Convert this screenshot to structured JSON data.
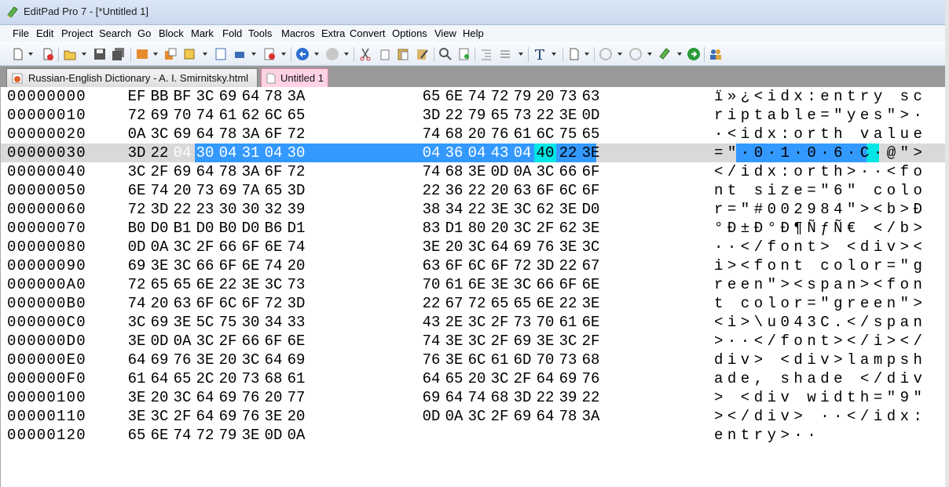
{
  "window": {
    "title": "EditPad Pro 7 - [*Untitled 1]"
  },
  "menu": [
    "File",
    "Edit",
    "Project",
    "Search",
    "Go",
    "Block",
    "Mark",
    "Fold",
    "Tools",
    "Macros",
    "Extra",
    "Convert",
    "Options",
    "View",
    "Help"
  ],
  "tabs": [
    {
      "label": "Russian-English Dictionary - A. I. Smirnitsky.html",
      "active": false
    },
    {
      "label": "Untitled 1",
      "active": true
    }
  ],
  "hex_rows": [
    {
      "addr": "00000000",
      "bytes": [
        "EF",
        "BB",
        "BF",
        "3C",
        "69",
        "64",
        "78",
        "3A",
        "65",
        "6E",
        "74",
        "72",
        "79",
        "20",
        "73",
        "63"
      ],
      "ascii": "ï»¿<idx:entry sc"
    },
    {
      "addr": "00000010",
      "bytes": [
        "72",
        "69",
        "70",
        "74",
        "61",
        "62",
        "6C",
        "65",
        "3D",
        "22",
        "79",
        "65",
        "73",
        "22",
        "3E",
        "0D"
      ],
      "ascii": "riptable=\"yes\">·"
    },
    {
      "addr": "00000020",
      "bytes": [
        "0A",
        "3C",
        "69",
        "64",
        "78",
        "3A",
        "6F",
        "72",
        "74",
        "68",
        "20",
        "76",
        "61",
        "6C",
        "75",
        "65"
      ],
      "ascii": "·<idx:orth value"
    },
    {
      "addr": "00000030",
      "bytes": [
        "3D",
        "22",
        "04",
        "30",
        "04",
        "31",
        "04",
        "30",
        "04",
        "36",
        "04",
        "43",
        "04",
        "40",
        "22",
        "3E"
      ],
      "ascii": "=\"·0·1·0·6·C·@\">"
    },
    {
      "addr": "00000040",
      "bytes": [
        "3C",
        "2F",
        "69",
        "64",
        "78",
        "3A",
        "6F",
        "72",
        "74",
        "68",
        "3E",
        "0D",
        "0A",
        "3C",
        "66",
        "6F"
      ],
      "ascii": "</idx:orth>··<fo"
    },
    {
      "addr": "00000050",
      "bytes": [
        "6E",
        "74",
        "20",
        "73",
        "69",
        "7A",
        "65",
        "3D",
        "22",
        "36",
        "22",
        "20",
        "63",
        "6F",
        "6C",
        "6F"
      ],
      "ascii": "nt size=\"6\" colo"
    },
    {
      "addr": "00000060",
      "bytes": [
        "72",
        "3D",
        "22",
        "23",
        "30",
        "30",
        "32",
        "39",
        "38",
        "34",
        "22",
        "3E",
        "3C",
        "62",
        "3E",
        "D0"
      ],
      "ascii": "r=\"#002984\"><b>Ð"
    },
    {
      "addr": "00000070",
      "bytes": [
        "B0",
        "D0",
        "B1",
        "D0",
        "B0",
        "D0",
        "B6",
        "D1",
        "83",
        "D1",
        "80",
        "20",
        "3C",
        "2F",
        "62",
        "3E"
      ],
      "ascii": "°Ð±Ð°Ð¶ÑƒÑ€ </b>"
    },
    {
      "addr": "00000080",
      "bytes": [
        "0D",
        "0A",
        "3C",
        "2F",
        "66",
        "6F",
        "6E",
        "74",
        "3E",
        "20",
        "3C",
        "64",
        "69",
        "76",
        "3E",
        "3C"
      ],
      "ascii": "··</font> <div><"
    },
    {
      "addr": "00000090",
      "bytes": [
        "69",
        "3E",
        "3C",
        "66",
        "6F",
        "6E",
        "74",
        "20",
        "63",
        "6F",
        "6C",
        "6F",
        "72",
        "3D",
        "22",
        "67"
      ],
      "ascii": "i><font color=\"g"
    },
    {
      "addr": "000000A0",
      "bytes": [
        "72",
        "65",
        "65",
        "6E",
        "22",
        "3E",
        "3C",
        "73",
        "70",
        "61",
        "6E",
        "3E",
        "3C",
        "66",
        "6F",
        "6E"
      ],
      "ascii": "reen\"><span><fon"
    },
    {
      "addr": "000000B0",
      "bytes": [
        "74",
        "20",
        "63",
        "6F",
        "6C",
        "6F",
        "72",
        "3D",
        "22",
        "67",
        "72",
        "65",
        "65",
        "6E",
        "22",
        "3E"
      ],
      "ascii": "t color=\"green\">"
    },
    {
      "addr": "000000C0",
      "bytes": [
        "3C",
        "69",
        "3E",
        "5C",
        "75",
        "30",
        "34",
        "33",
        "43",
        "2E",
        "3C",
        "2F",
        "73",
        "70",
        "61",
        "6E"
      ],
      "ascii": "<i>\\u043C.</span"
    },
    {
      "addr": "000000D0",
      "bytes": [
        "3E",
        "0D",
        "0A",
        "3C",
        "2F",
        "66",
        "6F",
        "6E",
        "74",
        "3E",
        "3C",
        "2F",
        "69",
        "3E",
        "3C",
        "2F"
      ],
      "ascii": ">··</font></i></"
    },
    {
      "addr": "000000E0",
      "bytes": [
        "64",
        "69",
        "76",
        "3E",
        "20",
        "3C",
        "64",
        "69",
        "76",
        "3E",
        "6C",
        "61",
        "6D",
        "70",
        "73",
        "68"
      ],
      "ascii": "div> <div>lampsh"
    },
    {
      "addr": "000000F0",
      "bytes": [
        "61",
        "64",
        "65",
        "2C",
        "20",
        "73",
        "68",
        "61",
        "64",
        "65",
        "20",
        "3C",
        "2F",
        "64",
        "69",
        "76"
      ],
      "ascii": "ade, shade </div"
    },
    {
      "addr": "00000100",
      "bytes": [
        "3E",
        "20",
        "3C",
        "64",
        "69",
        "76",
        "20",
        "77",
        "69",
        "64",
        "74",
        "68",
        "3D",
        "22",
        "39",
        "22"
      ],
      "ascii": "> <div width=\"9\""
    },
    {
      "addr": "00000110",
      "bytes": [
        "3E",
        "3C",
        "2F",
        "64",
        "69",
        "76",
        "3E",
        "20",
        "0D",
        "0A",
        "3C",
        "2F",
        "69",
        "64",
        "78",
        "3A"
      ],
      "ascii": "></div> ··</idx:"
    },
    {
      "addr": "00000120",
      "bytes": [
        "65",
        "6E",
        "74",
        "72",
        "79",
        "3E",
        "0D",
        "0A"
      ],
      "ascii": "entry>··"
    }
  ],
  "current_row": 3,
  "selected_bytes": [
    2,
    3,
    4,
    5,
    6,
    7,
    8,
    9,
    10,
    11,
    12
  ],
  "cursor_byte": 13,
  "colors": {
    "selection": "#3399ff",
    "cursor": "#00e5e5",
    "current_line": "#d9d9d9",
    "active_tab": "#ffd2e4"
  }
}
